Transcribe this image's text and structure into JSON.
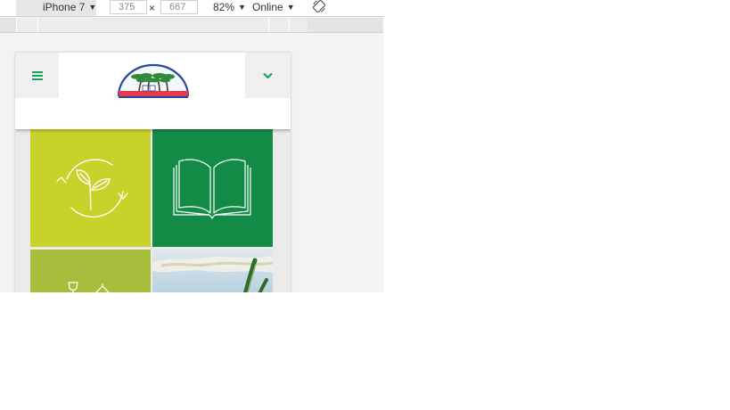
{
  "toolbar": {
    "device": "iPhone 7",
    "width_value": "375",
    "height_value": "667",
    "times": "×",
    "zoom": "82%",
    "network": "Online",
    "caret": "▼",
    "rotate_icon": "rotate-icon"
  },
  "site": {
    "menu_icon": "hamburger-icon",
    "chevron_icon": "chevron-down-icon",
    "accent_color": "#19a35a",
    "tiles": [
      {
        "icon": "recycle-leaf-icon",
        "color": "#c7d32b"
      },
      {
        "icon": "open-book-icon",
        "color": "#138a45"
      },
      {
        "icon": "wine-glass-icon",
        "color": "#a9bd3c"
      },
      {
        "icon": "palm-photo",
        "color": "#cfe0e6"
      }
    ]
  }
}
